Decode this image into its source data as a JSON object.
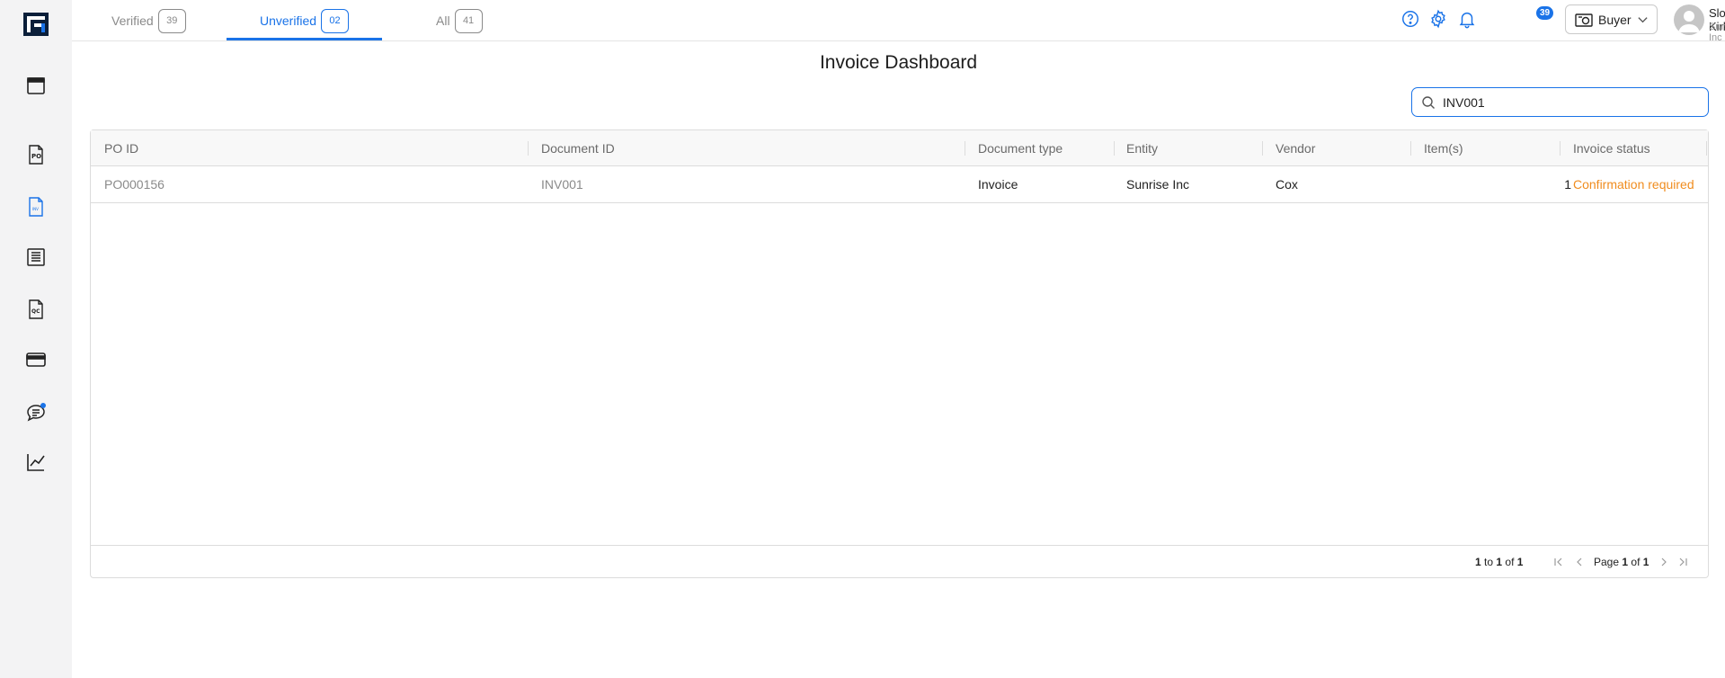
{
  "tabs": [
    {
      "label": "Verified",
      "count": "39"
    },
    {
      "label": "Unverified",
      "count": "02"
    },
    {
      "label": "All",
      "count": "41"
    }
  ],
  "header": {
    "notifications_count": "39",
    "role": "Buyer",
    "user_name": "Sloane Kirkby",
    "user_org": "Sunrise Inc"
  },
  "page_title": "Invoice Dashboard",
  "search": {
    "value": "INV001"
  },
  "table": {
    "columns": [
      "PO ID",
      "Document ID",
      "Document type",
      "Entity",
      "Vendor",
      "Item(s)",
      "Invoice status"
    ],
    "rows": [
      [
        "PO000156",
        "INV001",
        "Invoice",
        "Sunrise Inc",
        "Cox",
        "1",
        "Confirmation required"
      ]
    ]
  },
  "footer": {
    "range_start": "1",
    "range_to": "to",
    "range_end": "1",
    "range_of": "of",
    "range_total": "1",
    "page_label": "Page",
    "page_current": "1",
    "page_of": "of",
    "page_total": "1"
  },
  "colors": {
    "accent": "#1a73e8",
    "status_warning": "#f08c1e"
  },
  "icons": {
    "sidebar": [
      "calendar-icon",
      "purchase-order-icon",
      "invoice-icon",
      "ledger-icon",
      "quality-check-icon",
      "card-icon",
      "chat-icon",
      "analytics-icon"
    ]
  }
}
